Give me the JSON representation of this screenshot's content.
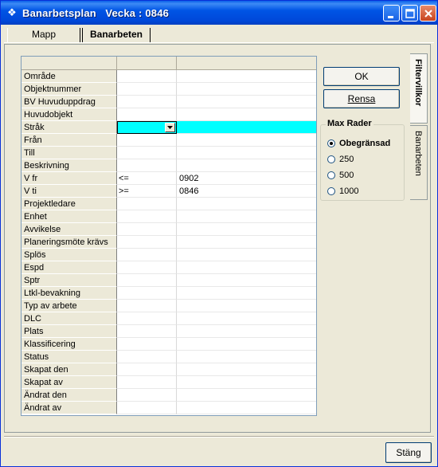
{
  "window": {
    "title": "Banarbetsplan   Vecka : 0846"
  },
  "top_tabs": [
    {
      "label": "Mapp"
    },
    {
      "label": "Banarbeten"
    }
  ],
  "grid": {
    "rows": [
      {
        "label": "Område",
        "op": "",
        "value": ""
      },
      {
        "label": "Objektnummer",
        "op": "",
        "value": ""
      },
      {
        "label": "BV Huvuduppdrag",
        "op": "",
        "value": ""
      },
      {
        "label": "Huvudobjekt",
        "op": "",
        "value": ""
      },
      {
        "label": "Stråk",
        "op": "",
        "value": ""
      },
      {
        "label": "Från",
        "op": "",
        "value": ""
      },
      {
        "label": "Till",
        "op": "",
        "value": ""
      },
      {
        "label": "Beskrivning",
        "op": "",
        "value": ""
      },
      {
        "label": "V fr",
        "op": "<=",
        "value": "0902"
      },
      {
        "label": "V ti",
        "op": ">=",
        "value": "0846"
      },
      {
        "label": "Projektledare",
        "op": "",
        "value": ""
      },
      {
        "label": "Enhet",
        "op": "",
        "value": ""
      },
      {
        "label": "Avvikelse",
        "op": "",
        "value": ""
      },
      {
        "label": "Planeringsmöte krävs",
        "op": "",
        "value": ""
      },
      {
        "label": "Splös",
        "op": "",
        "value": ""
      },
      {
        "label": "Espd",
        "op": "",
        "value": ""
      },
      {
        "label": "Sptr",
        "op": "",
        "value": ""
      },
      {
        "label": "Ltkl-bevakning",
        "op": "",
        "value": ""
      },
      {
        "label": "Typ av arbete",
        "op": "",
        "value": ""
      },
      {
        "label": "DLC",
        "op": "",
        "value": ""
      },
      {
        "label": "Plats",
        "op": "",
        "value": ""
      },
      {
        "label": "Klassificering",
        "op": "",
        "value": ""
      },
      {
        "label": "Status",
        "op": "",
        "value": ""
      },
      {
        "label": "Skapat den",
        "op": "",
        "value": ""
      },
      {
        "label": "Skapat av",
        "op": "",
        "value": ""
      },
      {
        "label": "Ändrat den",
        "op": "",
        "value": ""
      },
      {
        "label": "Ändrat av",
        "op": "",
        "value": ""
      }
    ]
  },
  "buttons": {
    "ok": "OK",
    "rensa": "Rensa",
    "stang": "Stäng"
  },
  "max_rader": {
    "title": "Max Rader",
    "options": [
      {
        "label": "Obegränsad",
        "selected": true
      },
      {
        "label": "250",
        "selected": false
      },
      {
        "label": "500",
        "selected": false
      },
      {
        "label": "1000",
        "selected": false
      }
    ]
  },
  "side_tabs": [
    {
      "label": "Filtervillkor",
      "active": true
    },
    {
      "label": "Banarbeten",
      "active": false
    }
  ],
  "colors": {
    "selection": "#00ffff",
    "titlebar": "#0055e5"
  }
}
